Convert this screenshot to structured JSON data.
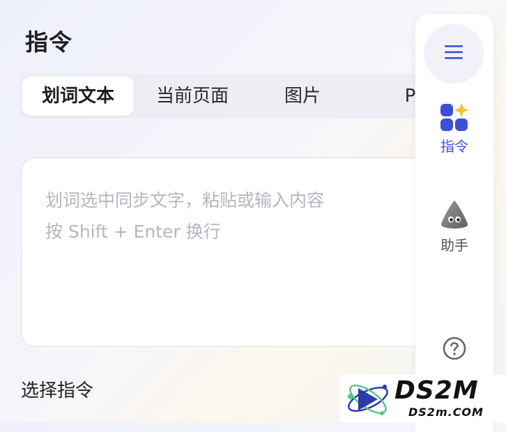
{
  "header": {
    "title": "指令"
  },
  "tabs": [
    {
      "label": "划词文本",
      "active": true
    },
    {
      "label": "当前页面",
      "active": false
    },
    {
      "label": "图片",
      "active": false
    },
    {
      "label": "PDF",
      "active": false
    }
  ],
  "input": {
    "placeholder_line1": "划词选中同步文字，粘贴或输入内容",
    "placeholder_line2": "按 Shift + Enter 换行"
  },
  "section": {
    "label": "选择指令"
  },
  "sidebar": {
    "items": [
      {
        "label": "指令",
        "icon": "apps-sparkle-icon",
        "active": true,
        "color": "#3c4fd8"
      },
      {
        "label": "助手",
        "icon": "assistant-mascot-icon",
        "active": false,
        "color": "#555555"
      }
    ],
    "help_icon": "help-circle-icon"
  },
  "watermark": {
    "brand": "DS2M",
    "domain": "DS2m.COM"
  },
  "colors": {
    "accent": "#3c4fd8",
    "sparkle": "#f2c23c"
  }
}
